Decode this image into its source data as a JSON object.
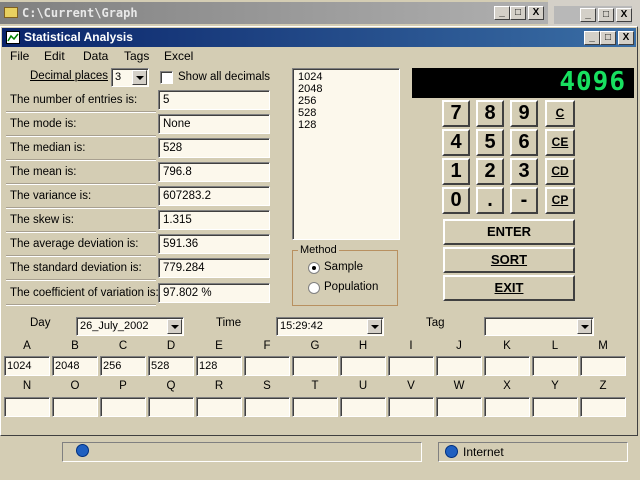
{
  "background_window": {
    "title": "C:\\Current\\Graph"
  },
  "window": {
    "title": "Statistical Analysis"
  },
  "caption_buttons": {
    "minimize": "_",
    "maximize": "□",
    "close": "X"
  },
  "menu": [
    "File",
    "Edit",
    "Data",
    "Tags",
    "Excel"
  ],
  "decimal": {
    "label": "Decimal places",
    "value": "3",
    "show_all_label": "Show all decimals"
  },
  "stats": [
    {
      "label": "The number of entries is:",
      "value": "5"
    },
    {
      "label": "The mode is:",
      "value": "None"
    },
    {
      "label": "The median is:",
      "value": "528"
    },
    {
      "label": "The mean is:",
      "value": "796.8"
    },
    {
      "label": "The variance is:",
      "value": "607283.2"
    },
    {
      "label": "The skew is:",
      "value": "1.315"
    },
    {
      "label": "The average deviation is:",
      "value": "591.36"
    },
    {
      "label": "The standard deviation is:",
      "value": "779.284"
    },
    {
      "label": "The coefficient of variation is:",
      "value": "97.802 %"
    }
  ],
  "entries_list": [
    "1024",
    "2048",
    "256",
    "528",
    "128"
  ],
  "display": {
    "value": "4096"
  },
  "keypad": {
    "row1": [
      "7",
      "8",
      "9",
      "C"
    ],
    "row2": [
      "4",
      "5",
      "6",
      "CE"
    ],
    "row3": [
      "1",
      "2",
      "3",
      "CD"
    ],
    "row4": [
      "0",
      ".",
      "-",
      "CP"
    ]
  },
  "buttons": {
    "enter": "ENTER",
    "sort": "SORT",
    "exit": "EXIT"
  },
  "method": {
    "title": "Method",
    "options": [
      "Sample",
      "Population"
    ],
    "selected": "Sample"
  },
  "datetime": {
    "day_label": "Day",
    "day_value": "26_July_2002",
    "time_label": "Time",
    "time_value": "15:29:42",
    "tag_label": "Tag",
    "tag_value": ""
  },
  "grid": {
    "row1_labels": [
      "A",
      "B",
      "C",
      "D",
      "E",
      "F",
      "G",
      "H",
      "I",
      "J",
      "K",
      "L",
      "M"
    ],
    "row1_values": [
      "1024",
      "2048",
      "256",
      "528",
      "128",
      "",
      "",
      "",
      "",
      "",
      "",
      "",
      ""
    ],
    "row2_labels": [
      "N",
      "O",
      "P",
      "Q",
      "R",
      "S",
      "T",
      "U",
      "V",
      "W",
      "X",
      "Y",
      "Z"
    ],
    "row2_values": [
      "",
      "",
      "",
      "",
      "",
      "",
      "",
      "",
      "",
      "",
      "",
      "",
      ""
    ]
  },
  "taskbar": {
    "status_text": "Internet"
  }
}
